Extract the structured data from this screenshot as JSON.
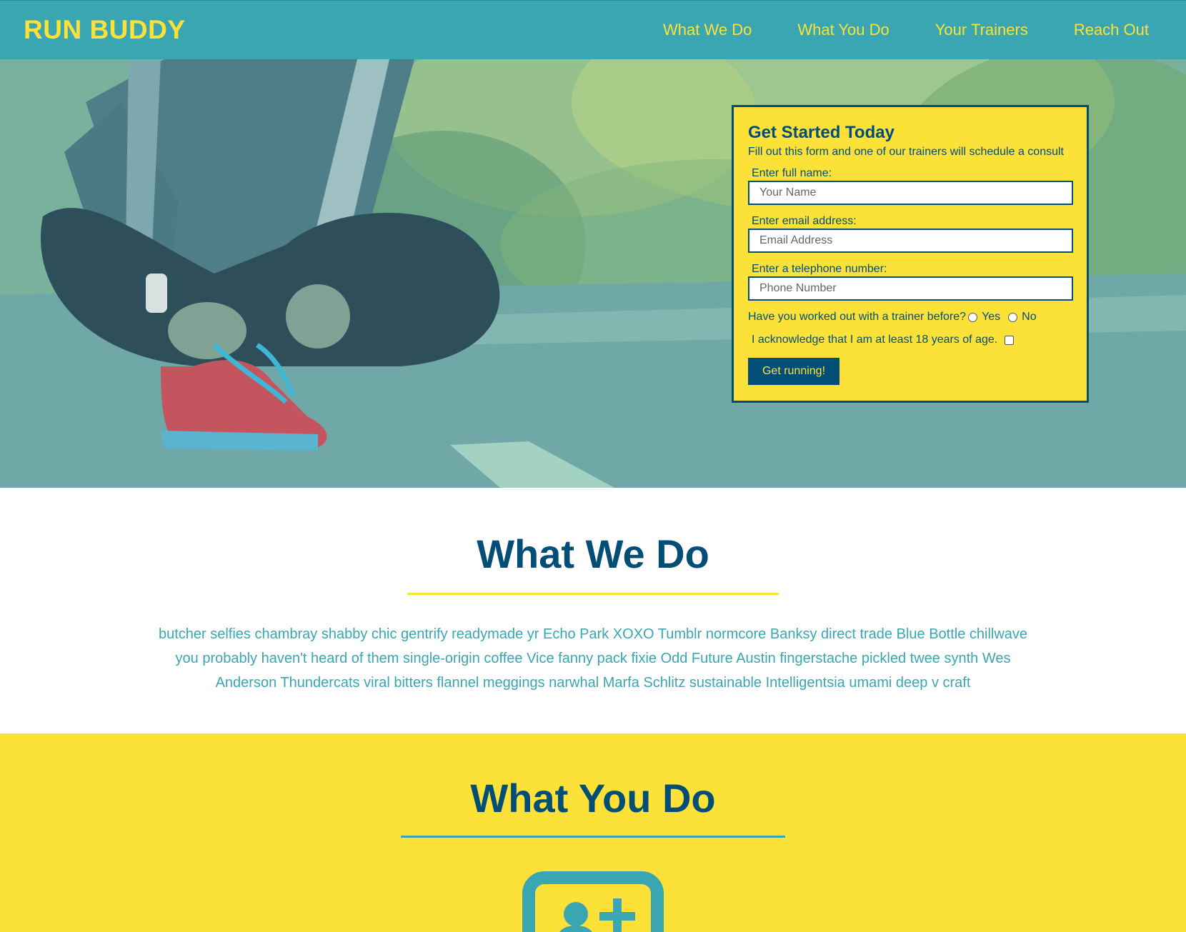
{
  "header": {
    "logo": "RUN BUDDY",
    "nav": [
      "What We Do",
      "What You Do",
      "Your Trainers",
      "Reach Out"
    ]
  },
  "form": {
    "title": "Get Started Today",
    "subtitle": "Fill out this form and one of our trainers will schedule a consult",
    "name_label": "Enter full name:",
    "name_placeholder": "Your Name",
    "email_label": "Enter email address:",
    "email_placeholder": "Email Address",
    "phone_label": "Enter a telephone number:",
    "phone_placeholder": "Phone Number",
    "trainer_question": "Have you worked out with a trainer before?",
    "yes_label": "Yes",
    "no_label": "No",
    "age_ack": "I acknowledge that I am at least 18 years of age.",
    "submit_label": "Get running!"
  },
  "what_we_do": {
    "title": "What We Do",
    "body": "butcher selfies chambray shabby chic gentrify readymade yr Echo Park XOXO Tumblr normcore Banksy direct trade Blue Bottle chillwave you probably haven't heard of them single-origin coffee Vice fanny pack fixie Odd Future Austin fingerstache pickled twee synth Wes Anderson Thundercats viral bitters flannel meggings narwhal Marfa Schlitz sustainable Intelligentsia umami deep v craft"
  },
  "what_you_do": {
    "title": "What You Do",
    "icon": "add-user-icon"
  },
  "colors": {
    "teal": "#39a6b2",
    "yellow": "#fce138",
    "navy": "#024e76"
  }
}
